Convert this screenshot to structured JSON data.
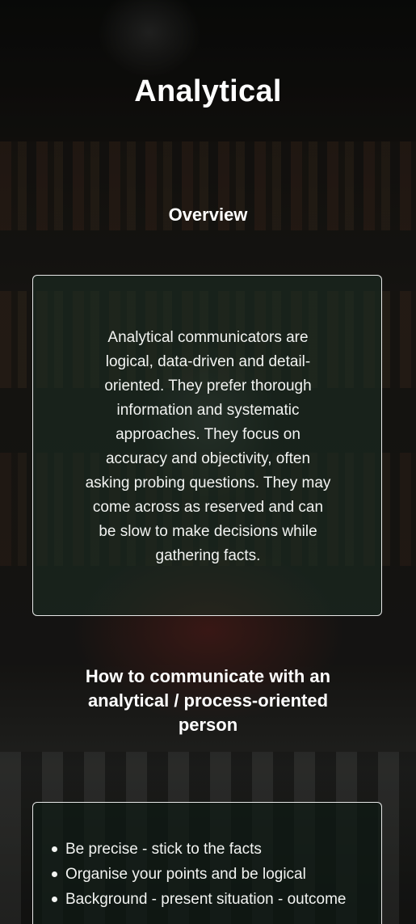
{
  "page": {
    "title": "Analytical"
  },
  "overview": {
    "heading": "Overview",
    "text": "Analytical communicators are logical, data-driven and detail-oriented. They prefer thorough information and systematic approaches. They focus on accuracy and objectivity, often asking probing questions. They may come across as reserved and can be slow to make decisions while gathering facts."
  },
  "howto": {
    "heading": "How to communicate with an analytical / process-oriented person",
    "tips": [
      "Be precise - stick to the facts",
      "Organise your points and be logical",
      "Background - present situation - outcome"
    ]
  }
}
